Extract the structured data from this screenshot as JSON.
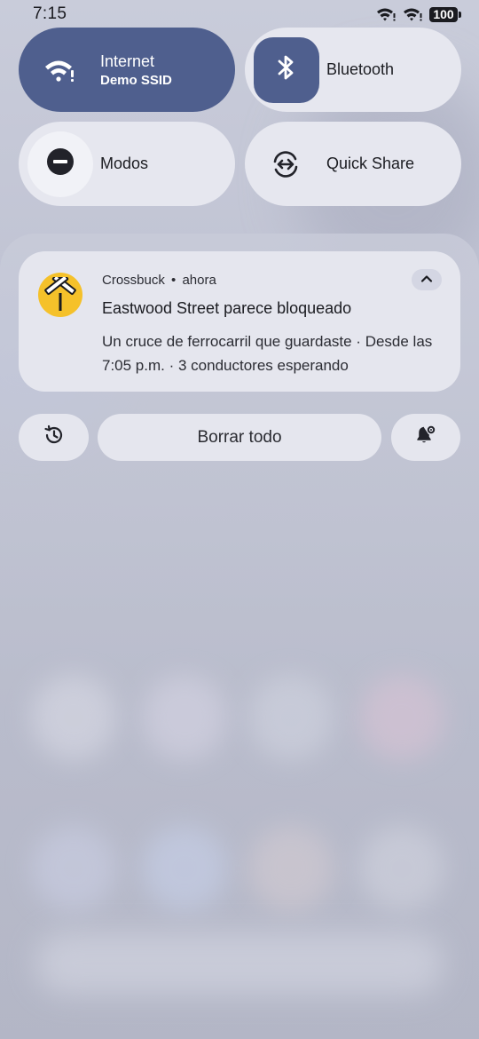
{
  "status_bar": {
    "time": "7:15",
    "battery": "100",
    "icons": [
      "wifi-alert-icon",
      "signal-alert-icon",
      "battery-icon"
    ]
  },
  "quick_settings": {
    "internet": {
      "label": "Internet",
      "sublabel": "Demo SSID",
      "icon": "wifi-icon",
      "active": true
    },
    "bluetooth": {
      "label": "Bluetooth",
      "icon": "bluetooth-icon",
      "active": true
    },
    "modes": {
      "label": "Modos",
      "icon": "do-not-disturb-icon",
      "active": false
    },
    "quick_share": {
      "label": "Quick Share",
      "icon": "quick-share-icon",
      "active": false
    }
  },
  "notification": {
    "app_name": "Crossbuck",
    "separator": "•",
    "time": "ahora",
    "title": "Eastwood Street parece bloqueado",
    "body": "Un cruce de ferrocarril que guardaste · Desde las 7:05 p.m. · 3 conductores esperando",
    "icon": "railroad-crossing-icon",
    "icon_color": "#f5c12a"
  },
  "actions": {
    "history_icon": "history-icon",
    "clear_all": "Borrar todo",
    "settings_icon": "notification-settings-icon"
  },
  "colors": {
    "active_tile": "#4f5f8e",
    "tile": "#e6e7ef",
    "card": "#e5e6ee"
  }
}
